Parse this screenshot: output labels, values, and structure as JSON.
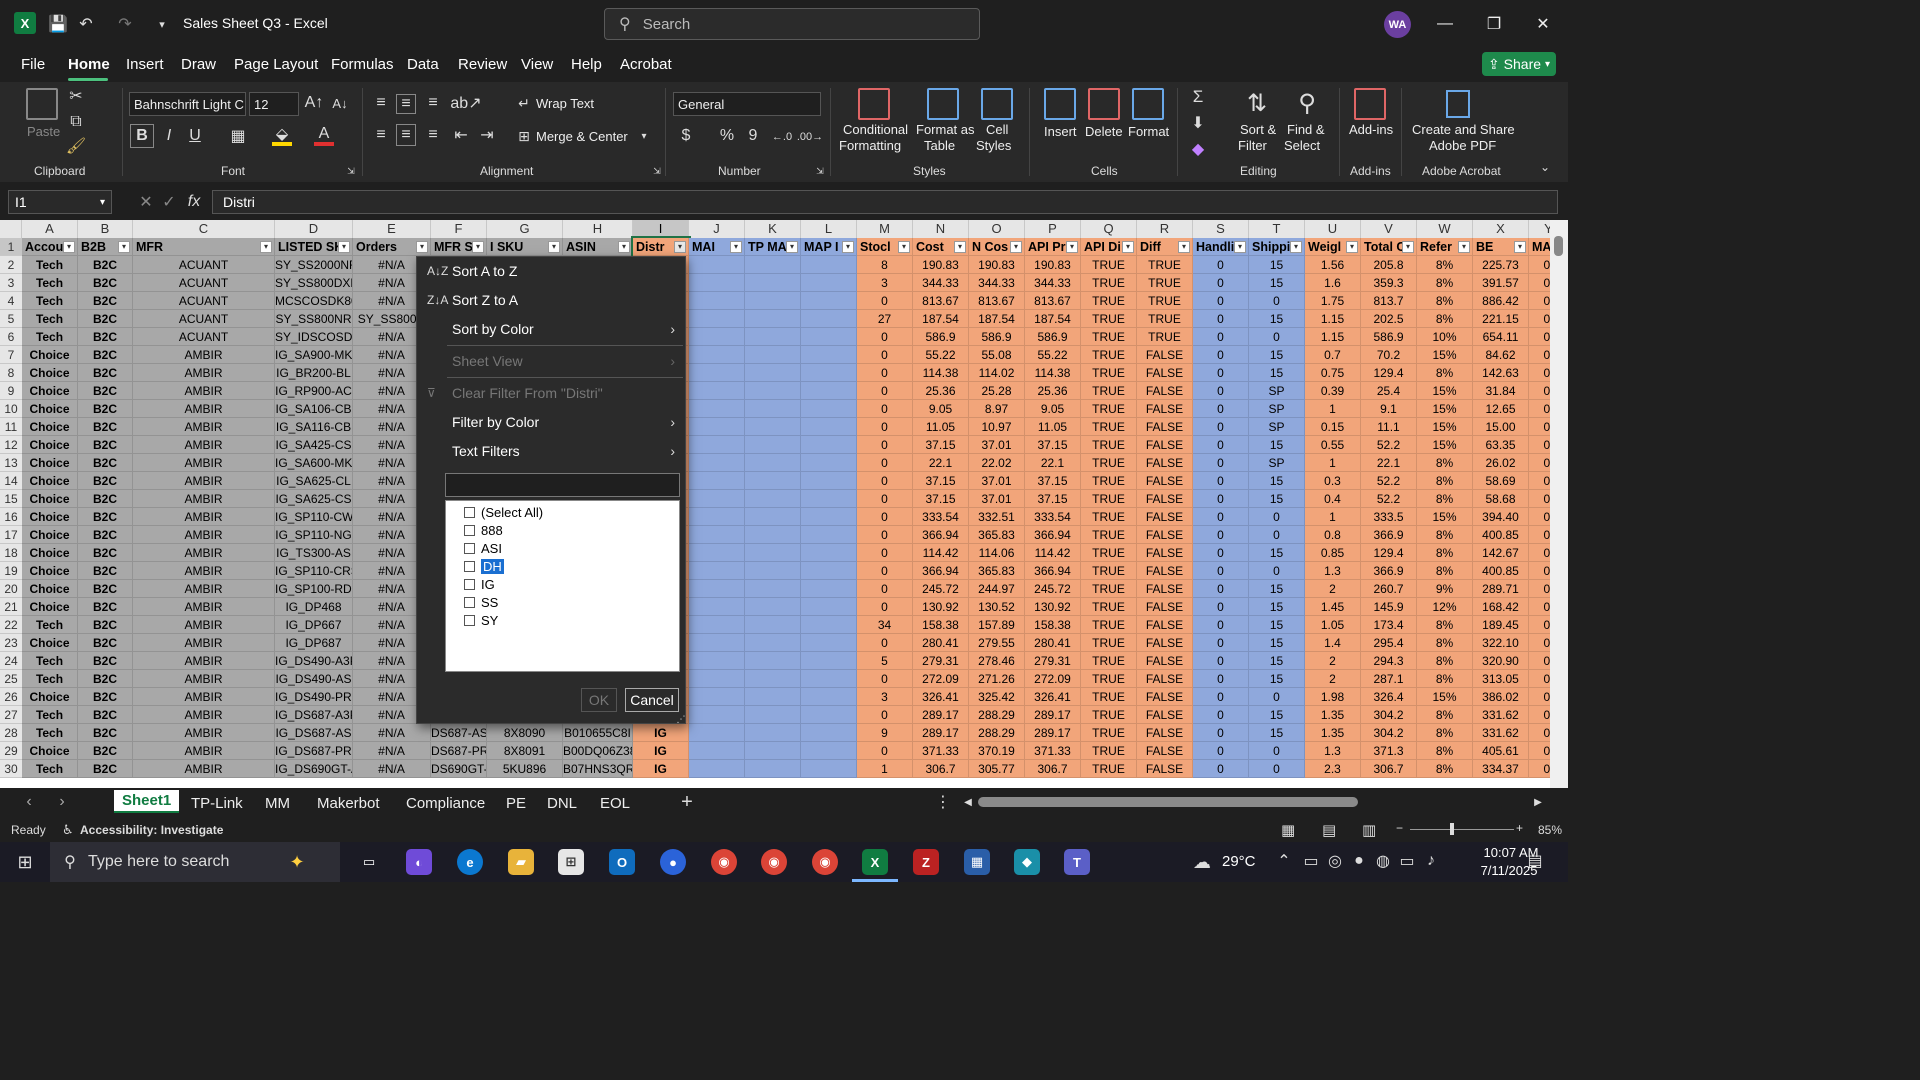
{
  "window": {
    "title": "Sales Sheet Q3 - Excel",
    "search_placeholder": "Search",
    "user_initials": "WA",
    "share_label": "Share"
  },
  "menu": [
    "File",
    "Home",
    "Insert",
    "Draw",
    "Page Layout",
    "Formulas",
    "Data",
    "Review",
    "View",
    "Help",
    "Acrobat"
  ],
  "ribbon": {
    "clipboard": {
      "label": "Clipboard",
      "paste": "Paste"
    },
    "font": {
      "label": "Font",
      "name": "Bahnschrift Light C",
      "size": "12",
      "bold": "B",
      "italic": "I",
      "underline": "U"
    },
    "alignment": {
      "label": "Alignment",
      "wrap": "Wrap Text",
      "merge": "Merge & Center"
    },
    "number": {
      "label": "Number",
      "format": "General",
      "currency": "$",
      "percent": "%",
      "comma": "9"
    },
    "styles": {
      "label": "Styles",
      "conditional": "Conditional",
      "conditional2": "Formatting",
      "table": "Format as",
      "table2": "Table",
      "cell": "Cell",
      "cell2": "Styles"
    },
    "cells": {
      "label": "Cells",
      "insert": "Insert",
      "delete": "Delete",
      "format": "Format"
    },
    "editing": {
      "label": "Editing",
      "sort": "Sort &",
      "sort2": "Filter",
      "find": "Find &",
      "find2": "Select"
    },
    "addins": {
      "label": "Add-ins",
      "btn": "Add-ins"
    },
    "acrobat": {
      "label": "Adobe Acrobat",
      "btn": "Create and Share",
      "btn2": "Adobe PDF"
    }
  },
  "formula_bar": {
    "namebox": "I1",
    "fx": "fx",
    "value": "Distri"
  },
  "columns": [
    "A",
    "B",
    "C",
    "D",
    "E",
    "F",
    "G",
    "H",
    "I",
    "J",
    "K",
    "L",
    "M",
    "N",
    "O",
    "P",
    "Q",
    "R",
    "S",
    "T",
    "U",
    "V",
    "W",
    "X",
    "Y"
  ],
  "headers": [
    "Accou",
    "B2B",
    "MFR",
    "LISTED SK",
    "Orders",
    "MFR S",
    "I SKU",
    "ASIN",
    "Distr",
    "MAI",
    "TP MA",
    "MAP I",
    "Stocl",
    "Cost",
    "N Cos",
    "API Pri",
    "API Di",
    "Diff",
    "Handli",
    "Shippi",
    "Weigl",
    "Total C",
    "Refer",
    "BE",
    "MAP"
  ],
  "rows": [
    [
      "Tech",
      "B2C",
      "ACUANT",
      "SY_SS2000NR",
      "#N/A",
      "",
      "",
      "",
      "",
      "",
      "",
      "",
      "8",
      "190.83",
      "190.83",
      "190.83",
      "TRUE",
      "TRUE",
      "0",
      "15",
      "1.56",
      "205.8",
      "8%",
      "225.73",
      "0."
    ],
    [
      "Tech",
      "B2C",
      "ACUANT",
      "SY_SS800DXN",
      "#N/A",
      "",
      "",
      "",
      "",
      "",
      "",
      "",
      "3",
      "344.33",
      "344.33",
      "344.33",
      "TRUE",
      "TRUE",
      "0",
      "15",
      "1.6",
      "359.3",
      "8%",
      "391.57",
      "0."
    ],
    [
      "Tech",
      "B2C",
      "ACUANT",
      "MCSCOSDK800DX-",
      "#N/A",
      "",
      "",
      "",
      "",
      "",
      "",
      "",
      "0",
      "813.67",
      "813.67",
      "813.67",
      "TRUE",
      "TRUE",
      "0",
      "0",
      "1.75",
      "813.7",
      "8%",
      "886.42",
      "0."
    ],
    [
      "Tech",
      "B2C",
      "ACUANT",
      "SY_SS800NR",
      "SY_SS800N",
      "",
      "",
      "",
      "",
      "",
      "",
      "",
      "27",
      "187.54",
      "187.54",
      "187.54",
      "TRUE",
      "TRUE",
      "0",
      "15",
      "1.15",
      "202.5",
      "8%",
      "221.15",
      "0."
    ],
    [
      "Tech",
      "B2C",
      "ACUANT",
      "SY_IDSCOSDK800R",
      "#N/A",
      "",
      "",
      "",
      "",
      "",
      "",
      "",
      "0",
      "586.9",
      "586.9",
      "586.9",
      "TRUE",
      "TRUE",
      "0",
      "0",
      "1.15",
      "586.9",
      "10%",
      "654.11",
      "0."
    ],
    [
      "Choice",
      "B2C",
      "AMBIR",
      "IG_SA900-MK",
      "#N/A",
      "",
      "",
      "",
      "",
      "",
      "",
      "",
      "0",
      "55.22",
      "55.08",
      "55.22",
      "TRUE",
      "FALSE",
      "0",
      "15",
      "0.7",
      "70.2",
      "15%",
      "84.62",
      "0."
    ],
    [
      "Choice",
      "B2C",
      "AMBIR",
      "IG_BR200-BL",
      "#N/A",
      "",
      "",
      "",
      "",
      "",
      "",
      "",
      "0",
      "114.38",
      "114.02",
      "114.38",
      "TRUE",
      "FALSE",
      "0",
      "15",
      "0.75",
      "129.4",
      "8%",
      "142.63",
      "0."
    ],
    [
      "Choice",
      "B2C",
      "AMBIR",
      "IG_RP900-AC",
      "#N/A",
      "",
      "",
      "",
      "",
      "",
      "",
      "",
      "0",
      "25.36",
      "25.28",
      "25.36",
      "TRUE",
      "FALSE",
      "0",
      "SP",
      "0.39",
      "25.4",
      "15%",
      "31.84",
      "0."
    ],
    [
      "Choice",
      "B2C",
      "AMBIR",
      "IG_SA106-CB",
      "#N/A",
      "",
      "",
      "",
      "",
      "",
      "",
      "",
      "0",
      "9.05",
      "8.97",
      "9.05",
      "TRUE",
      "FALSE",
      "0",
      "SP",
      "1",
      "9.1",
      "15%",
      "12.65",
      "0."
    ],
    [
      "Choice",
      "B2C",
      "AMBIR",
      "IG_SA116-CB",
      "#N/A",
      "",
      "",
      "",
      "",
      "",
      "",
      "",
      "0",
      "11.05",
      "10.97",
      "11.05",
      "TRUE",
      "FALSE",
      "0",
      "SP",
      "0.15",
      "11.1",
      "15%",
      "15.00",
      "0."
    ],
    [
      "Choice",
      "B2C",
      "AMBIR",
      "IG_SA425-CS",
      "#N/A",
      "",
      "",
      "",
      "",
      "",
      "",
      "",
      "0",
      "37.15",
      "37.01",
      "37.15",
      "TRUE",
      "FALSE",
      "0",
      "15",
      "0.55",
      "52.2",
      "15%",
      "63.35",
      "0."
    ],
    [
      "Choice",
      "B2C",
      "AMBIR",
      "IG_SA600-MK",
      "#N/A",
      "",
      "",
      "",
      "",
      "",
      "",
      "",
      "0",
      "22.1",
      "22.02",
      "22.1",
      "TRUE",
      "FALSE",
      "0",
      "SP",
      "1",
      "22.1",
      "8%",
      "26.02",
      "0."
    ],
    [
      "Choice",
      "B2C",
      "AMBIR",
      "IG_SA625-CL",
      "#N/A",
      "",
      "",
      "",
      "",
      "",
      "",
      "",
      "0",
      "37.15",
      "37.01",
      "37.15",
      "TRUE",
      "FALSE",
      "0",
      "15",
      "0.3",
      "52.2",
      "8%",
      "58.69",
      "0."
    ],
    [
      "Choice",
      "B2C",
      "AMBIR",
      "IG_SA625-CS",
      "#N/A",
      "",
      "",
      "",
      "",
      "",
      "",
      "",
      "0",
      "37.15",
      "37.01",
      "37.15",
      "TRUE",
      "FALSE",
      "0",
      "15",
      "0.4",
      "52.2",
      "8%",
      "58.68",
      "0."
    ],
    [
      "Choice",
      "B2C",
      "AMBIR",
      "IG_SP110-CWS",
      "#N/A",
      "",
      "",
      "",
      "",
      "",
      "",
      "",
      "0",
      "333.54",
      "332.51",
      "333.54",
      "TRUE",
      "FALSE",
      "0",
      "0",
      "1",
      "333.5",
      "15%",
      "394.40",
      "0."
    ],
    [
      "Choice",
      "B2C",
      "AMBIR",
      "IG_SP110-NG",
      "#N/A",
      "",
      "",
      "",
      "",
      "",
      "",
      "",
      "0",
      "366.94",
      "365.83",
      "366.94",
      "TRUE",
      "FALSE",
      "0",
      "0",
      "0.8",
      "366.9",
      "8%",
      "400.85",
      "0."
    ],
    [
      "Choice",
      "B2C",
      "AMBIR",
      "IG_TS300-AS",
      "#N/A",
      "",
      "",
      "",
      "",
      "",
      "",
      "",
      "0",
      "114.42",
      "114.06",
      "114.42",
      "TRUE",
      "FALSE",
      "0",
      "15",
      "0.85",
      "129.4",
      "8%",
      "142.67",
      "0."
    ],
    [
      "Choice",
      "B2C",
      "AMBIR",
      "IG_SP110-CRS",
      "#N/A",
      "",
      "",
      "",
      "",
      "",
      "",
      "",
      "0",
      "366.94",
      "365.83",
      "366.94",
      "TRUE",
      "FALSE",
      "0",
      "0",
      "1.3",
      "366.9",
      "8%",
      "400.85",
      "0."
    ],
    [
      "Choice",
      "B2C",
      "AMBIR",
      "IG_SP100-RDP",
      "#N/A",
      "",
      "",
      "",
      "",
      "",
      "",
      "",
      "0",
      "245.72",
      "244.97",
      "245.72",
      "TRUE",
      "FALSE",
      "0",
      "15",
      "2",
      "260.7",
      "9%",
      "289.71",
      "0."
    ],
    [
      "Choice",
      "B2C",
      "AMBIR",
      "IG_DP468",
      "#N/A",
      "",
      "",
      "",
      "",
      "",
      "",
      "",
      "0",
      "130.92",
      "130.52",
      "130.92",
      "TRUE",
      "FALSE",
      "0",
      "15",
      "1.45",
      "145.9",
      "12%",
      "168.42",
      "0."
    ],
    [
      "Tech",
      "B2C",
      "AMBIR",
      "IG_DP667",
      "#N/A",
      "",
      "",
      "",
      "",
      "",
      "",
      "",
      "34",
      "158.38",
      "157.89",
      "158.38",
      "TRUE",
      "FALSE",
      "0",
      "15",
      "1.05",
      "173.4",
      "8%",
      "189.45",
      "0."
    ],
    [
      "Choice",
      "B2C",
      "AMBIR",
      "IG_DP687",
      "#N/A",
      "",
      "",
      "",
      "",
      "",
      "",
      "",
      "0",
      "280.41",
      "279.55",
      "280.41",
      "TRUE",
      "FALSE",
      "0",
      "15",
      "1.4",
      "295.4",
      "8%",
      "322.10",
      "0."
    ],
    [
      "Tech",
      "B2C",
      "AMBIR",
      "IG_DS490-A3P",
      "#N/A",
      "",
      "",
      "",
      "",
      "",
      "",
      "",
      "5",
      "279.31",
      "278.46",
      "279.31",
      "TRUE",
      "FALSE",
      "0",
      "15",
      "2",
      "294.3",
      "8%",
      "320.90",
      "0."
    ],
    [
      "Tech",
      "B2C",
      "AMBIR",
      "IG_DS490-AS",
      "#N/A",
      "",
      "",
      "",
      "",
      "",
      "",
      "",
      "0",
      "272.09",
      "271.26",
      "272.09",
      "TRUE",
      "FALSE",
      "0",
      "15",
      "2",
      "287.1",
      "8%",
      "313.05",
      "0."
    ],
    [
      "Choice",
      "B2C",
      "AMBIR",
      "IG_DS490-PRO",
      "#N/A",
      "",
      "",
      "",
      "",
      "",
      "",
      "",
      "3",
      "326.41",
      "325.42",
      "326.41",
      "TRUE",
      "FALSE",
      "0",
      "0",
      "1.98",
      "326.4",
      "15%",
      "386.02",
      "0."
    ],
    [
      "Tech",
      "B2C",
      "AMBIR",
      "IG_DS687-A3P",
      "#N/A",
      "",
      "",
      "",
      "",
      "",
      "",
      "",
      "0",
      "289.17",
      "288.29",
      "289.17",
      "TRUE",
      "FALSE",
      "0",
      "15",
      "1.35",
      "304.2",
      "8%",
      "331.62",
      "0."
    ],
    [
      "Tech",
      "B2C",
      "AMBIR",
      "IG_DS687-AS",
      "#N/A",
      "DS687-AS",
      "8X8090",
      "B010655C8I",
      "IG",
      "",
      "",
      "",
      "9",
      "289.17",
      "288.29",
      "289.17",
      "TRUE",
      "FALSE",
      "0",
      "15",
      "1.35",
      "304.2",
      "8%",
      "331.62",
      "0."
    ],
    [
      "Choice",
      "B2C",
      "AMBIR",
      "IG_DS687-PRO",
      "#N/A",
      "DS687-PRO",
      "8X8091",
      "B00DQ06Z38",
      "IG",
      "",
      "",
      "",
      "0",
      "371.33",
      "370.19",
      "371.33",
      "TRUE",
      "FALSE",
      "0",
      "0",
      "1.3",
      "371.3",
      "8%",
      "405.61",
      "0."
    ],
    [
      "Tech",
      "B2C",
      "AMBIR",
      "IG_DS690GT-AS",
      "#N/A",
      "DS690GT-AS",
      "5KU896",
      "B07HNS3QRR",
      "IG",
      "",
      "",
      "",
      "1",
      "306.7",
      "305.77",
      "306.7",
      "TRUE",
      "FALSE",
      "0",
      "0",
      "2.3",
      "306.7",
      "8%",
      "334.37",
      "0."
    ]
  ],
  "filter_menu": {
    "sort_az": "Sort A to Z",
    "sort_za": "Sort Z to A",
    "sort_color": "Sort by Color",
    "sheet_view": "Sheet View",
    "clear_filter": "Clear Filter From \"Distri\"",
    "filter_color": "Filter by Color",
    "text_filters": "Text Filters",
    "options": [
      "(Select All)",
      "888",
      "ASI",
      "DH",
      "IG",
      "SS",
      "SY"
    ],
    "ok": "OK",
    "cancel": "Cancel"
  },
  "sheets": [
    "Sheet1",
    "TP-Link",
    "MM",
    "Makerbot",
    "Compliance",
    "PE",
    "DNL",
    "EOL"
  ],
  "status": {
    "ready": "Ready",
    "accessibility": "Accessibility: Investigate",
    "zoom": "85%"
  },
  "taskbar": {
    "search": "Type here to search",
    "temp": "29°C",
    "time": "10:07 AM",
    "date": "7/11/2025"
  }
}
